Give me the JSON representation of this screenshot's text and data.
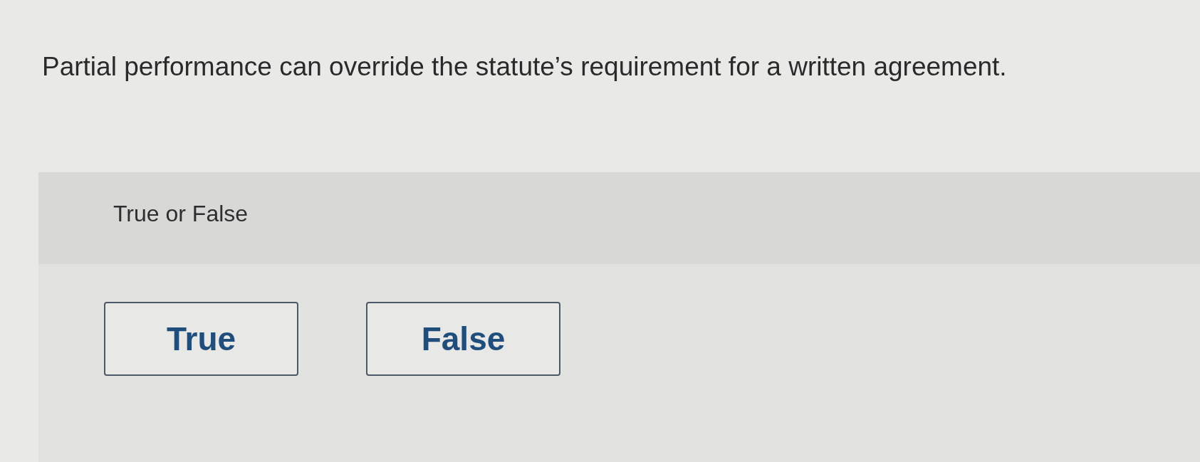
{
  "question": {
    "text": "Partial performance can override the statute’s requirement for a written agreement."
  },
  "prompt": {
    "label": "True or False"
  },
  "options": [
    {
      "label": "True",
      "selected": false
    },
    {
      "label": "False",
      "selected": false
    }
  ]
}
